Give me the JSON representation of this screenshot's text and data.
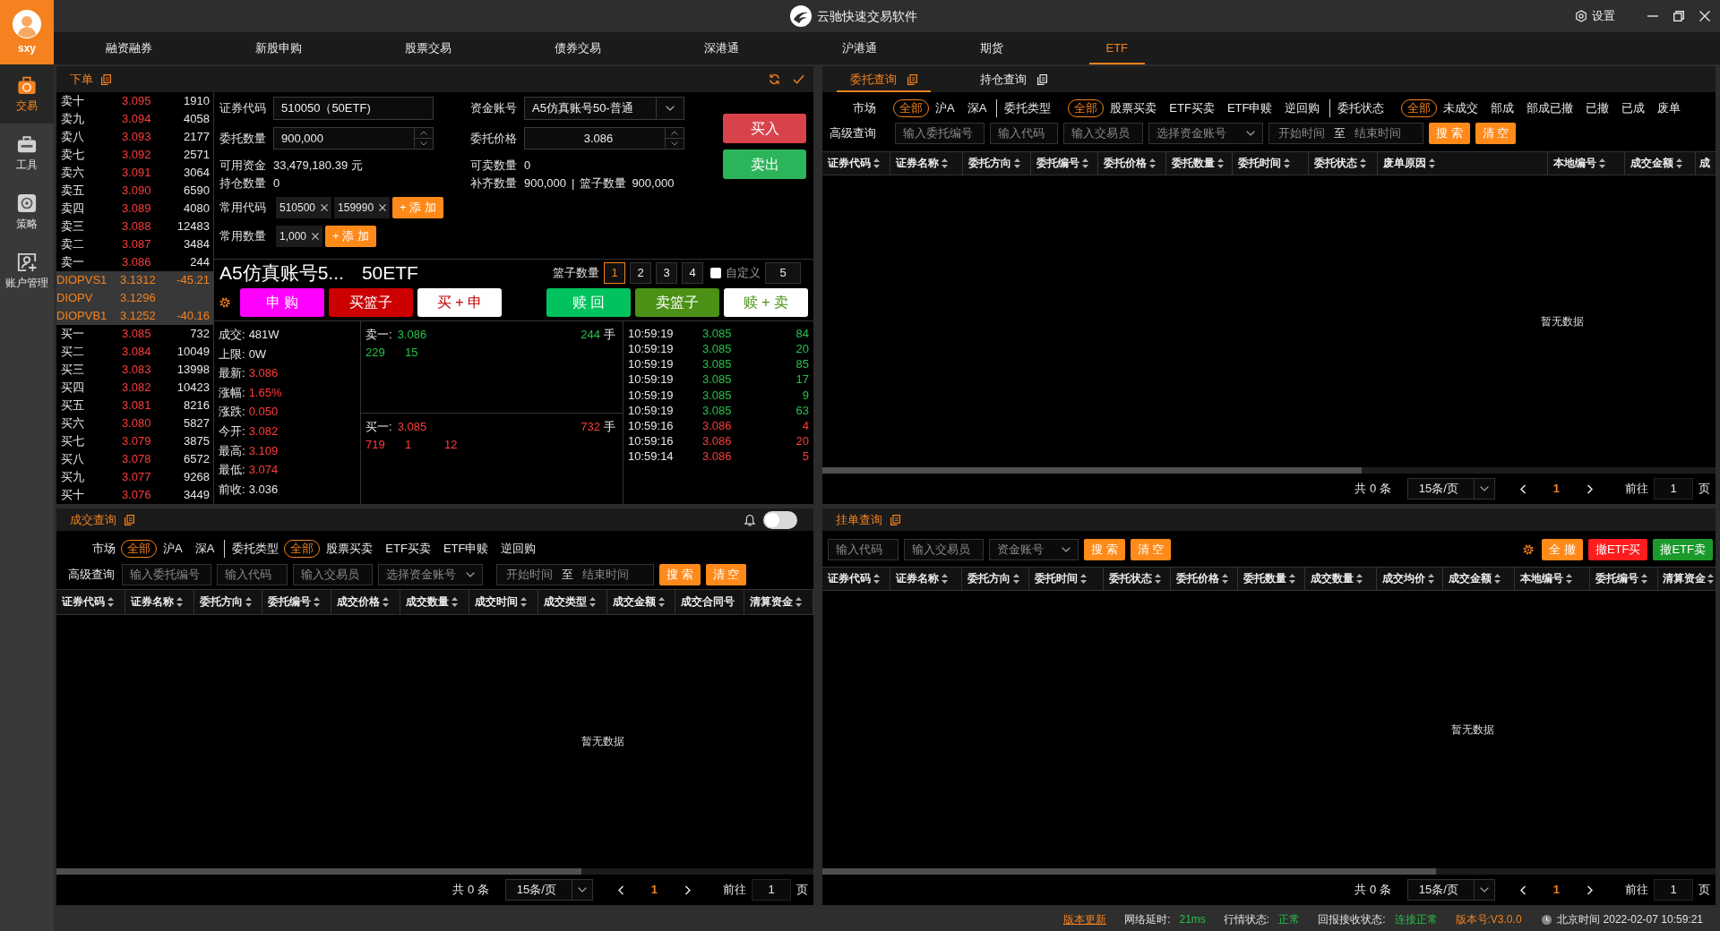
{
  "window": {
    "title": "云驰快速交易软件",
    "settings_label": "设置"
  },
  "user": {
    "name": "sxy"
  },
  "sidebar": {
    "items": [
      {
        "label": "交易",
        "selected": true
      },
      {
        "label": "工具",
        "selected": false
      },
      {
        "label": "策略",
        "selected": false
      },
      {
        "label": "账户管理",
        "selected": false
      }
    ]
  },
  "nav_tabs": [
    {
      "label": "融资融券",
      "selected": false
    },
    {
      "label": "新股申购",
      "selected": false
    },
    {
      "label": "股票交易",
      "selected": false
    },
    {
      "label": "债券交易",
      "selected": false
    },
    {
      "label": "深港通",
      "selected": false
    },
    {
      "label": "沪港通",
      "selected": false
    },
    {
      "label": "期货",
      "selected": false
    },
    {
      "label": "ETF",
      "selected": true
    }
  ],
  "order_panel": {
    "title": "下单",
    "order_book": {
      "asks": [
        {
          "label": "卖十",
          "price": "3.095",
          "volume": "1910"
        },
        {
          "label": "卖九",
          "price": "3.094",
          "volume": "4058"
        },
        {
          "label": "卖八",
          "price": "3.093",
          "volume": "2177"
        },
        {
          "label": "卖七",
          "price": "3.092",
          "volume": "2571"
        },
        {
          "label": "卖六",
          "price": "3.091",
          "volume": "3064"
        },
        {
          "label": "卖五",
          "price": "3.090",
          "volume": "6590"
        },
        {
          "label": "卖四",
          "price": "3.089",
          "volume": "4080"
        },
        {
          "label": "卖三",
          "price": "3.088",
          "volume": "12483"
        },
        {
          "label": "卖二",
          "price": "3.087",
          "volume": "3484"
        },
        {
          "label": "卖一",
          "price": "3.086",
          "volume": "244"
        }
      ],
      "diopv": [
        {
          "label": "DIOPVS1",
          "value": "3.1312",
          "change": "-45.21"
        },
        {
          "label": "DIOPV",
          "value": "3.1296"
        },
        {
          "label": "DIOPVB1",
          "value": "3.1252",
          "change": "-40.16"
        }
      ],
      "bids": [
        {
          "label": "买一",
          "price": "3.085",
          "volume": "732"
        },
        {
          "label": "买二",
          "price": "3.084",
          "volume": "10049"
        },
        {
          "label": "买三",
          "price": "3.083",
          "volume": "13998"
        },
        {
          "label": "买四",
          "price": "3.082",
          "volume": "10423"
        },
        {
          "label": "买五",
          "price": "3.081",
          "volume": "8216"
        },
        {
          "label": "买六",
          "price": "3.080",
          "volume": "5827"
        },
        {
          "label": "买七",
          "price": "3.079",
          "volume": "3875"
        },
        {
          "label": "买八",
          "price": "3.078",
          "volume": "6572"
        },
        {
          "label": "买九",
          "price": "3.077",
          "volume": "9268"
        },
        {
          "label": "买十",
          "price": "3.076",
          "volume": "3449"
        }
      ]
    },
    "form": {
      "security_code": {
        "label": "证券代码",
        "value": "510050（50ETF)"
      },
      "fund_account": {
        "label": "资金账号",
        "value": "A5仿真账号50-普通"
      },
      "quantity": {
        "label": "委托数量",
        "value": "900,000"
      },
      "price": {
        "label": "委托价格",
        "value": "3.086"
      },
      "available_funds": {
        "label": "可用资金",
        "value": "33,479,180.39 元"
      },
      "sellable": {
        "label": "可卖数量",
        "value": "0"
      },
      "position": {
        "label": "持仓数量",
        "value": "0"
      },
      "fill_quantity": {
        "label": "补齐数量",
        "value": "900,000"
      },
      "stat_separator": "|",
      "basket_quantity": {
        "label": "篮子数量",
        "value": "900,000"
      },
      "common_codes": {
        "label": "常用代码",
        "items": [
          "510500",
          "159990"
        ],
        "add_label": "+ 添 加"
      },
      "common_quantities": {
        "label": "常用数量",
        "items": [
          "1,000"
        ],
        "add_label": "+ 添 加"
      },
      "buy_label": "买入",
      "sell_label": "卖出"
    },
    "account_title": "A5仿真账号5...",
    "security_title": "50ETF",
    "basket": {
      "label": "篮子数量",
      "options": [
        {
          "label": "1",
          "selected": true
        },
        {
          "label": "2",
          "selected": false
        },
        {
          "label": "3",
          "selected": false
        },
        {
          "label": "4",
          "selected": false
        }
      ],
      "custom": {
        "label": "自定义",
        "checked": false,
        "value": "5"
      }
    },
    "actions": [
      {
        "label": "申 购",
        "kind": "subscribe"
      },
      {
        "label": "买篮子",
        "kind": "buy_basket"
      },
      {
        "label": "买 + 申",
        "kind": "buy_subscribe"
      },
      {
        "label": "赎 回",
        "kind": "redeem"
      },
      {
        "label": "卖篮子",
        "kind": "sell_basket"
      },
      {
        "label": "赎 + 卖",
        "kind": "redeem_sell"
      }
    ],
    "quote": [
      {
        "label": "成交:",
        "value": "481W",
        "rising": false
      },
      {
        "label": "上限:",
        "value": "0W",
        "rising": false
      },
      {
        "label": "最新:",
        "value": "3.086",
        "rising": true
      },
      {
        "label": "涨幅:",
        "value": "1.65%",
        "rising": true
      },
      {
        "label": "涨跌:",
        "value": "0.050",
        "rising": true
      },
      {
        "label": "今开:",
        "value": "3.082",
        "rising": true
      },
      {
        "label": "最高:",
        "value": "3.109",
        "rising": true
      },
      {
        "label": "最低:",
        "value": "3.074",
        "rising": true
      },
      {
        "label": "前收:",
        "value": "3.036",
        "rising": false
      }
    ],
    "depth": {
      "ask": {
        "label": "卖一:",
        "price": "3.086",
        "volume": "244",
        "unit": "手",
        "queue": [
          "229",
          "15"
        ]
      },
      "bid": {
        "label": "买一:",
        "price": "3.085",
        "volume": "732",
        "unit": "手",
        "queue": [
          "719",
          "1",
          "12"
        ]
      }
    },
    "ticks": [
      {
        "time": "10:59:19",
        "price": "3.085",
        "volume": "84",
        "rising": false
      },
      {
        "time": "10:59:19",
        "price": "3.085",
        "volume": "20",
        "rising": false
      },
      {
        "time": "10:59:19",
        "price": "3.085",
        "volume": "85",
        "rising": false
      },
      {
        "time": "10:59:19",
        "price": "3.085",
        "volume": "17",
        "rising": false
      },
      {
        "time": "10:59:19",
        "price": "3.085",
        "volume": "9",
        "rising": false
      },
      {
        "time": "10:59:19",
        "price": "3.085",
        "volume": "63",
        "rising": false
      },
      {
        "time": "10:59:16",
        "price": "3.086",
        "volume": "4",
        "rising": true
      },
      {
        "time": "10:59:16",
        "price": "3.086",
        "volume": "20",
        "rising": true
      },
      {
        "time": "10:59:14",
        "price": "3.086",
        "volume": "5",
        "rising": true
      }
    ]
  },
  "orders_panel": {
    "tabs": [
      {
        "label": "委托查询",
        "selected": true
      },
      {
        "label": "持仓查询",
        "selected": false
      }
    ],
    "filters": [
      {
        "label": "市场",
        "options": [
          {
            "label": "全部",
            "selected": true
          },
          {
            "label": "沪A",
            "selected": false
          },
          {
            "label": "深A",
            "selected": false
          }
        ]
      },
      {
        "label": "委托类型",
        "options": [
          {
            "label": "全部",
            "selected": true
          },
          {
            "label": "股票买卖",
            "selected": false
          },
          {
            "label": "ETF买卖",
            "selected": false
          },
          {
            "label": "ETF申赎",
            "selected": false
          },
          {
            "label": "逆回购",
            "selected": false
          }
        ]
      },
      {
        "label": "委托状态",
        "options": [
          {
            "label": "全部",
            "selected": true
          },
          {
            "label": "未成交",
            "selected": false
          },
          {
            "label": "部成",
            "selected": false
          },
          {
            "label": "部成已撤",
            "selected": false
          },
          {
            "label": "已撤",
            "selected": false
          },
          {
            "label": "已成",
            "selected": false
          },
          {
            "label": "废单",
            "selected": false
          }
        ]
      }
    ],
    "search": {
      "label": "高级查询",
      "fields": [
        {
          "kind": "text",
          "placeholder": "输入委托编号"
        },
        {
          "kind": "text",
          "placeholder": "输入代码"
        },
        {
          "kind": "text",
          "placeholder": "输入交易员"
        },
        {
          "kind": "select",
          "placeholder": "选择资金账号"
        },
        {
          "kind": "daterange",
          "placeholder": "开始时间",
          "separator": "至",
          "end_placeholder": "结束时间"
        }
      ],
      "buttons": [
        "搜 索",
        "清 空"
      ]
    },
    "table": {
      "columns": [
        {
          "label": "证券代码",
          "sortable": true
        },
        {
          "label": "证券名称",
          "sortable": true
        },
        {
          "label": "委托方向",
          "sortable": true
        },
        {
          "label": "委托编号",
          "sortable": true
        },
        {
          "label": "委托价格",
          "sortable": true
        },
        {
          "label": "委托数量",
          "sortable": true
        },
        {
          "label": "委托时间",
          "sortable": true
        },
        {
          "label": "委托状态",
          "sortable": true
        },
        {
          "label": "废单原因",
          "sortable": true
        },
        {
          "label": "本地编号",
          "sortable": true
        },
        {
          "label": "成交金额",
          "sortable": true
        },
        {
          "label": "成",
          "sortable": false
        }
      ],
      "empty_text": "暂无数据"
    },
    "pagination": {
      "total": "共 0 条",
      "page_size": "15条/页",
      "current": "1",
      "goto_label": "前往",
      "goto_value": "1",
      "page_suffix": "页"
    }
  },
  "trades_panel": {
    "title": "成交查询",
    "alert_toggle": {
      "on": false
    },
    "filters": [
      {
        "label": "市场",
        "options": [
          {
            "label": "全部",
            "selected": true
          },
          {
            "label": "沪A",
            "selected": false
          },
          {
            "label": "深A",
            "selected": false
          }
        ]
      },
      {
        "label": "委托类型",
        "options": [
          {
            "label": "全部",
            "selected": true
          },
          {
            "label": "股票买卖",
            "selected": false
          },
          {
            "label": "ETF买卖",
            "selected": false
          },
          {
            "label": "ETF申赎",
            "selected": false
          },
          {
            "label": "逆回购",
            "selected": false
          }
        ]
      }
    ],
    "search": {
      "label": "高级查询",
      "fields": [
        {
          "kind": "text",
          "placeholder": "输入委托编号"
        },
        {
          "kind": "text",
          "placeholder": "输入代码"
        },
        {
          "kind": "text",
          "placeholder": "输入交易员"
        },
        {
          "kind": "select",
          "placeholder": "选择资金账号"
        },
        {
          "kind": "daterange",
          "placeholder": "开始时间",
          "separator": "至",
          "end_placeholder": "结束时间"
        }
      ],
      "buttons": [
        "搜 索",
        "清 空"
      ]
    },
    "table": {
      "columns": [
        {
          "label": "证券代码",
          "sortable": true
        },
        {
          "label": "证券名称",
          "sortable": true
        },
        {
          "label": "委托方向",
          "sortable": true
        },
        {
          "label": "委托编号",
          "sortable": true
        },
        {
          "label": "成交价格",
          "sortable": true
        },
        {
          "label": "成交数量",
          "sortable": true
        },
        {
          "label": "成交时间",
          "sortable": true
        },
        {
          "label": "成交类型",
          "sortable": true
        },
        {
          "label": "成交金额",
          "sortable": true
        },
        {
          "label": "成交合同号",
          "sortable": false
        },
        {
          "label": "清算资金",
          "sortable": true
        }
      ],
      "empty_text": "暂无数据"
    },
    "pagination": {
      "total": "共 0 条",
      "page_size": "15条/页",
      "current": "1",
      "goto_label": "前往",
      "goto_value": "1",
      "page_suffix": "页"
    }
  },
  "pending_panel": {
    "title": "挂单查询",
    "search": {
      "fields": [
        {
          "kind": "text",
          "placeholder": "输入代码"
        },
        {
          "kind": "text",
          "placeholder": "输入交易员"
        },
        {
          "kind": "select",
          "placeholder": "资金账号"
        }
      ],
      "buttons": [
        "搜 索",
        "清 空"
      ]
    },
    "actions": [
      {
        "label": "全 撤",
        "kind": "cancel_all"
      },
      {
        "label": "撤ETF买",
        "kind": "cancel_buy"
      },
      {
        "label": "撤ETF卖",
        "kind": "cancel_sell"
      }
    ],
    "table": {
      "columns": [
        {
          "label": "证券代码",
          "sortable": true
        },
        {
          "label": "证券名称",
          "sortable": true
        },
        {
          "label": "委托方向",
          "sortable": true
        },
        {
          "label": "委托时间",
          "sortable": true
        },
        {
          "label": "委托状态",
          "sortable": true
        },
        {
          "label": "委托价格",
          "sortable": true
        },
        {
          "label": "委托数量",
          "sortable": true
        },
        {
          "label": "成交数量",
          "sortable": true
        },
        {
          "label": "成交均价",
          "sortable": true
        },
        {
          "label": "成交金额",
          "sortable": true
        },
        {
          "label": "本地编号",
          "sortable": true
        },
        {
          "label": "委托编号",
          "sortable": true
        },
        {
          "label": "清算资金",
          "sortable": true
        }
      ],
      "empty_text": "暂无数据"
    },
    "pagination": {
      "total": "共 0 条",
      "page_size": "15条/页",
      "current": "1",
      "goto_label": "前往",
      "goto_value": "1",
      "page_suffix": "页"
    }
  },
  "status_bar": {
    "items": [
      {
        "kind": "link",
        "label": "版本更新"
      },
      {
        "kind": "status",
        "label": "网络延时:",
        "value": "21ms"
      },
      {
        "kind": "status",
        "label": "行情状态:",
        "value": "正常"
      },
      {
        "kind": "status",
        "label": "回报接收状态:",
        "value": "连接正常"
      },
      {
        "kind": "version",
        "label": "版本号:",
        "value": "V3.0.0"
      },
      {
        "kind": "clock",
        "label": "北京时间",
        "value": "2022-02-07 10:59:21"
      }
    ]
  }
}
